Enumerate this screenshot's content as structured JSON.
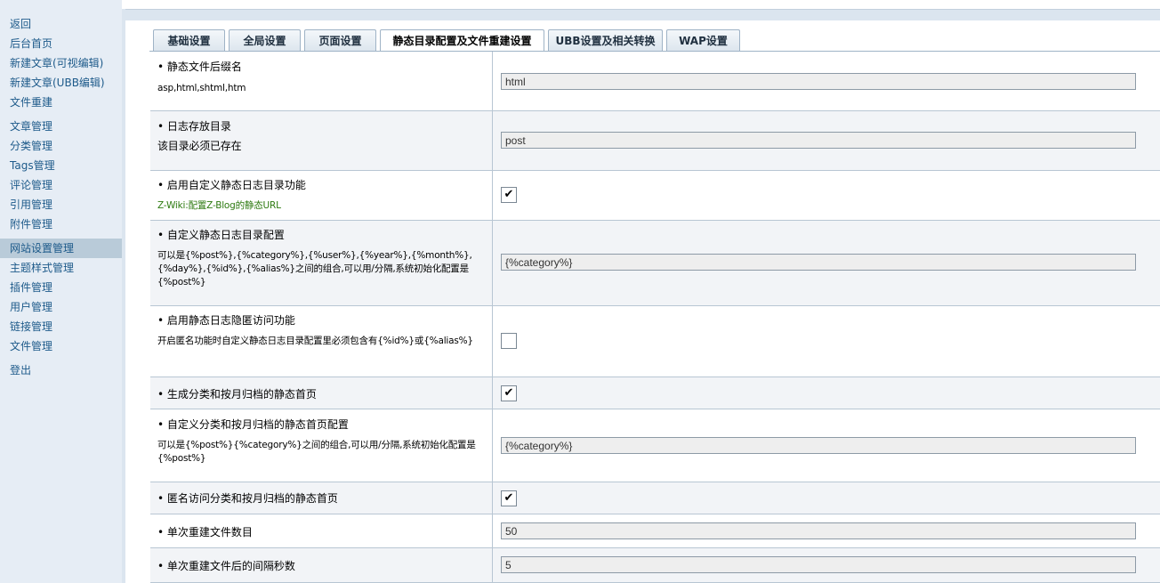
{
  "sidebar": {
    "items": [
      {
        "label": "返回"
      },
      {
        "label": "后台首页"
      },
      {
        "label": "新建文章(可视编辑)"
      },
      {
        "label": "新建文章(UBB编辑)"
      },
      {
        "label": "文件重建"
      },
      {
        "label": "文章管理"
      },
      {
        "label": "分类管理"
      },
      {
        "label": "Tags管理"
      },
      {
        "label": "评论管理"
      },
      {
        "label": "引用管理"
      },
      {
        "label": "附件管理"
      },
      {
        "label": "网站设置管理"
      },
      {
        "label": "主题样式管理"
      },
      {
        "label": "插件管理"
      },
      {
        "label": "用户管理"
      },
      {
        "label": "链接管理"
      },
      {
        "label": "文件管理"
      },
      {
        "label": "登出"
      }
    ],
    "active_index": 11
  },
  "tabs": [
    {
      "label": "基础设置"
    },
    {
      "label": "全局设置"
    },
    {
      "label": "页面设置"
    },
    {
      "label": "静态目录配置及文件重建设置"
    },
    {
      "label": "UBB设置及相关转换"
    },
    {
      "label": "WAP设置"
    }
  ],
  "settings": [
    {
      "title": "静态文件后缀名",
      "desc": "asp,html,shtml,htm",
      "value": "html"
    },
    {
      "title": "日志存放目录",
      "desc": "该目录必须已存在",
      "value": "post"
    },
    {
      "title": "启用自定义静态日志目录功能",
      "link": "Z-Wiki:配置Z-Blog的静态URL",
      "checked": true
    },
    {
      "title": "自定义静态日志目录配置",
      "desc": "可以是{%post%},{%category%},{%user%},{%year%},{%month%},{%day%},{%id%},{%alias%}之间的组合,可以用/分隔,系统初始化配置是{%post%}",
      "value": "{%category%}"
    },
    {
      "title": "启用静态日志隐匿访问功能",
      "desc": "开启匿名功能时自定义静态日志目录配置里必须包含有{%id%}或{%alias%}",
      "checked": false
    },
    {
      "title": "生成分类和按月归档的静态首页",
      "checked": true
    },
    {
      "title": "自定义分类和按月归档的静态首页配置",
      "desc": "可以是{%post%}{%category%}之间的组合,可以用/分隔,系统初始化配置是{%post%}",
      "value": "{%category%}"
    },
    {
      "title": "匿名访问分类和按月归档的静态首页",
      "checked": true
    },
    {
      "title": "单次重建文件数目",
      "value": "50"
    },
    {
      "title": "单次重建文件后的间隔秒数",
      "value": "5"
    }
  ],
  "colors": {
    "sidebar_bg": "#e6edf5",
    "link": "#1d5a8a",
    "wiki_link": "#2d7a10",
    "active_item": "#b9cbd9"
  },
  "icons": {
    "checkbox_checked": "check-mark"
  }
}
